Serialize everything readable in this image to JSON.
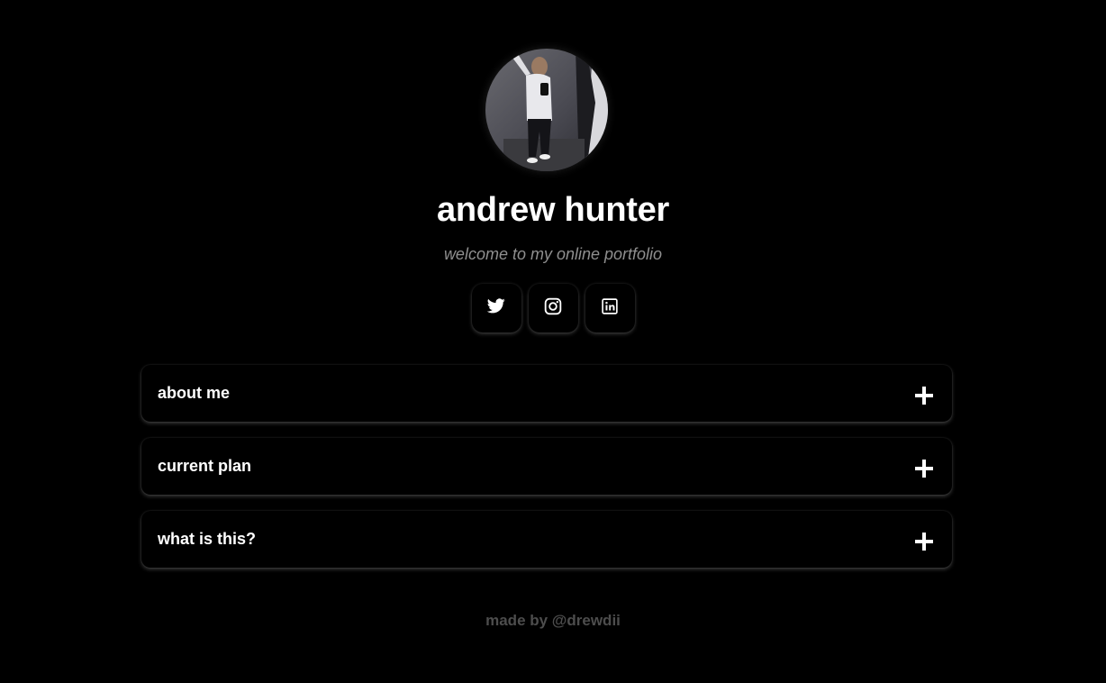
{
  "profile": {
    "name": "andrew hunter",
    "tagline": "welcome to my online portfolio"
  },
  "socials": [
    {
      "icon": "twitter-icon",
      "label": "twitter"
    },
    {
      "icon": "instagram-icon",
      "label": "instagram"
    },
    {
      "icon": "linkedin-icon",
      "label": "linkedin"
    }
  ],
  "sections": [
    {
      "label": "about me"
    },
    {
      "label": "current plan"
    },
    {
      "label": "what is this?"
    }
  ],
  "footer": {
    "text": "made by @drewdii"
  },
  "colors": {
    "background": "#000000",
    "text": "#ffffff",
    "tagline": "#8f8f8f",
    "footer": "#4d4d4d"
  }
}
